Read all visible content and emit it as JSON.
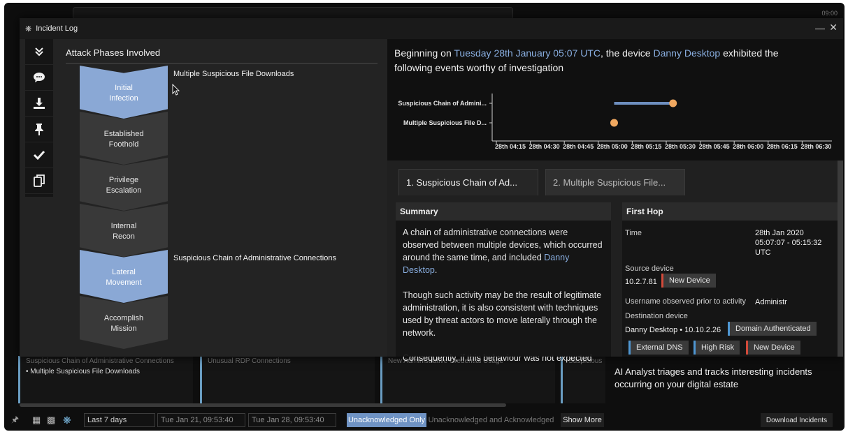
{
  "window": {
    "title": "Incident Log"
  },
  "sidebar": [
    {
      "name": "collapse",
      "icon": "double-chevron-down-icon"
    },
    {
      "name": "comment",
      "icon": "comment-icon"
    },
    {
      "name": "download",
      "icon": "download-icon"
    },
    {
      "name": "pin",
      "icon": "pin-icon"
    },
    {
      "name": "acknowledge",
      "icon": "check-icon"
    },
    {
      "name": "copy",
      "icon": "copy-icon"
    }
  ],
  "phases": {
    "title": "Attack Phases Involved",
    "items": [
      {
        "label": "Initial\nInfection",
        "active": true,
        "event": "Multiple Suspicious File Downloads"
      },
      {
        "label": "Established\nFoothold",
        "active": false,
        "event": ""
      },
      {
        "label": "Privilege\nEscalation",
        "active": false,
        "event": ""
      },
      {
        "label": "Internal\nRecon",
        "active": false,
        "event": ""
      },
      {
        "label": "Lateral\nMovement",
        "active": true,
        "event": "Suspicious Chain of Administrative Connections"
      },
      {
        "label": "Accomplish\nMission",
        "active": false,
        "event": ""
      }
    ]
  },
  "headline": {
    "pre": "Beginning on ",
    "date": "Tuesday 28th January 05:07 UTC",
    "mid": ", the device ",
    "device": "Danny Desktop",
    "post": " exhibited the following events worthy of investigation"
  },
  "chart_data": {
    "type": "scatter",
    "categories": [
      "Suspicious Chain of Admini...",
      "Multiple Suspicious File D..."
    ],
    "x_ticks": [
      "28th 04:15",
      "28th 04:30",
      "28th 04:45",
      "28th 05:00",
      "28th 05:15",
      "28th 05:30",
      "28th 05:45",
      "28th 06:00",
      "28th 06:15",
      "28th 06:30"
    ],
    "series": [
      {
        "category": "Suspicious Chain of Admini...",
        "start": "28th 05:07",
        "end": "28th 05:33"
      },
      {
        "category": "Multiple Suspicious File D...",
        "start": "28th 05:07",
        "end": "28th 05:07"
      }
    ],
    "colors": {
      "line": "#6e8fbf",
      "point": "#f0a860"
    }
  },
  "tabs": [
    {
      "label": "1. Suspicious Chain of Ad...",
      "active": true
    },
    {
      "label": "2. Multiple Suspicious File...",
      "active": false
    }
  ],
  "summary": {
    "title": "Summary",
    "p1_pre": "A chain of administrative connections were observed between multiple devices, which occurred around the same time, and included ",
    "p1_link": "Danny Desktop",
    "p1_post": ".",
    "p2": "Though such activity may be the result of legitimate administration, it is also consistent with techniques used by threat actors to move laterally through the network.",
    "p3": "Consequently, if this behaviour was not expected"
  },
  "first_hop": {
    "title": "First Hop",
    "time_label": "Time",
    "time_value": "28th Jan 2020\n05:07:07 - 05:15:32\nUTC",
    "source_label": "Source device",
    "source_ip": "10.2.7.81",
    "source_tag": "New Device",
    "username_label": "Username observed prior to activity",
    "username_value": "Administr",
    "dest_label": "Destination device",
    "dest_value": "Danny Desktop • 10.10.2.26",
    "dest_tag": "Domain Authenticated",
    "tags": [
      "External DNS",
      "High Risk",
      "New Device"
    ]
  },
  "background": {
    "time": "09:00",
    "card_lines": [
      "Suspicious Chain of Administrative Connections",
      "• Multiple Suspicious File Downloads",
      "Unusual RDP Connections",
      "New Administrative Credential Usage",
      "Suspicious"
    ],
    "ai_analyst": "AI Analyst triages and tracks interesting incidents occurring on your digital estate"
  },
  "bottom": {
    "range": "Last 7 days",
    "from": "Tue Jan 21, 09:53:40",
    "to": "Tue Jan 28, 09:53:40",
    "toggle_a": "Unacknowledged Only",
    "toggle_b": "Unacknowledged and Acknowledged",
    "show_more": "Show More",
    "download": "Download Incidents"
  }
}
